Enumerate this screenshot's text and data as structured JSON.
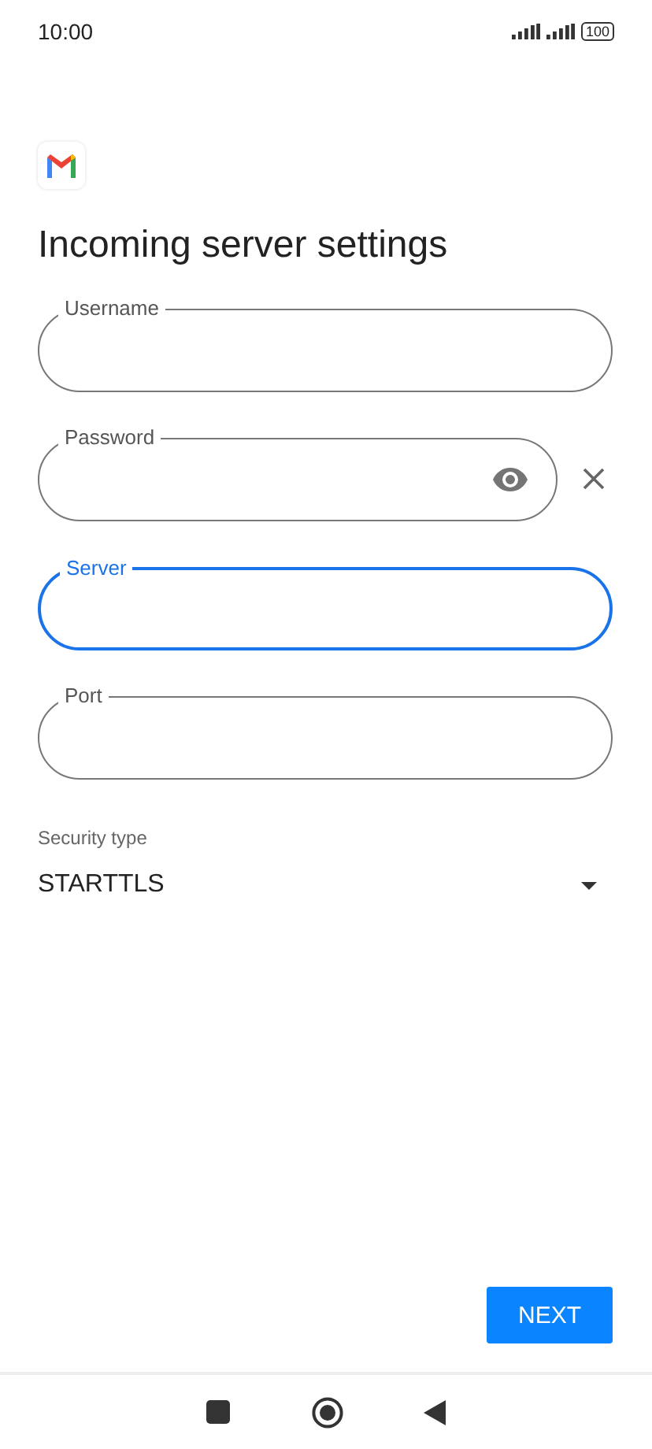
{
  "status_bar": {
    "time": "10:00",
    "battery": "100"
  },
  "title": "Incoming server settings",
  "fields": [
    {
      "kind": "text",
      "label": "Username",
      "focused": false
    },
    {
      "kind": "password",
      "label": "Password",
      "focused": false
    },
    {
      "kind": "text",
      "label": "Server",
      "focused": true
    },
    {
      "kind": "text",
      "label": "Port",
      "focused": false
    }
  ],
  "security": {
    "label": "Security type",
    "value": "STARTTLS"
  },
  "buttons": [
    "NEXT"
  ]
}
